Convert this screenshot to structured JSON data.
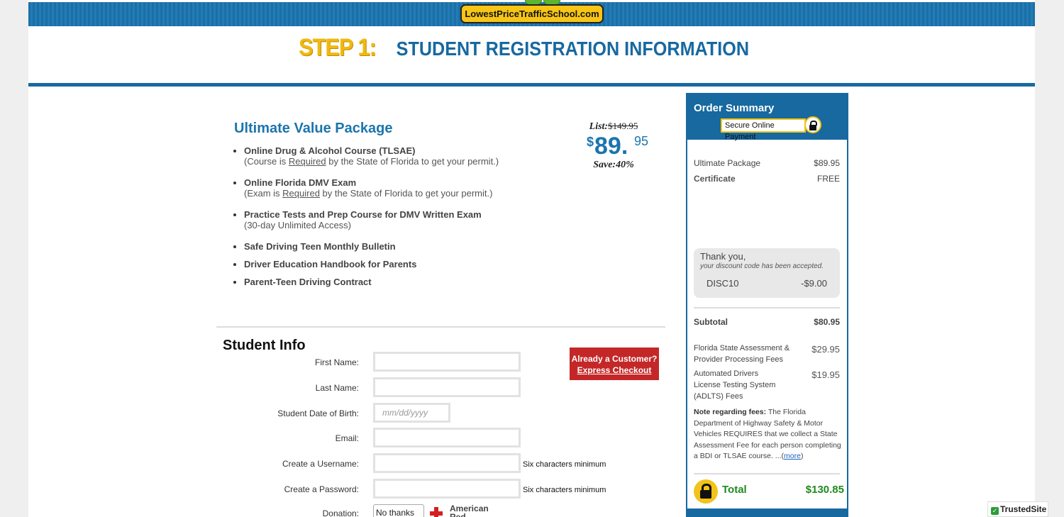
{
  "header": {
    "logo": "LowestPriceTrafficSchool.com",
    "step_num": "STEP 1:",
    "step_text": "STUDENT REGISTRATION INFORMATION"
  },
  "package": {
    "title": "Ultimate Value Package",
    "features": [
      {
        "name": "Online Drug & Alcohol Course (TLSAE)",
        "note_pre": "(Course is ",
        "note_u": "Required",
        "note_post": " by the State of Florida to get your permit.)"
      },
      {
        "name": "Online Florida DMV Exam",
        "note_pre": "(Exam is ",
        "note_u": "Required",
        "note_post": " by the State of Florida to get your permit.)"
      },
      {
        "name": "Practice Tests and Prep Course for DMV Written Exam",
        "note_pre": "(30-day Unlimited Access)",
        "note_u": "",
        "note_post": ""
      },
      {
        "name": "Safe Driving Teen Monthly Bulletin"
      },
      {
        "name": "Driver Education Handbook for Parents"
      },
      {
        "name": "Parent-Teen Driving Contract"
      }
    ],
    "list_label": "List:",
    "list_price": "$149.95",
    "price_dollar": "$",
    "price_whole": "89.",
    "price_cents": "95",
    "save": "Save:40%"
  },
  "student_info": {
    "title": "Student Info",
    "first_name_label": "First Name:",
    "last_name_label": "Last Name:",
    "dob_label": "Student Date of Birth:",
    "dob_placeholder": "mm/dd/yyyy",
    "email_label": "Email:",
    "username_label": "Create a Username:",
    "username_hint": "Six characters minimum",
    "password_label": "Create a Password:",
    "password_hint": "Six characters minimum",
    "donation_label": "Donation:",
    "donation_selected": "No thanks",
    "donation_org": "American Red Cross"
  },
  "already_customer": {
    "line1": "Already a Customer?",
    "line2": "Express Checkout"
  },
  "order_summary": {
    "title": "Order Summary",
    "secure": "Secure Online Payment",
    "items": [
      {
        "label": "Ultimate Package",
        "amount": "$89.95"
      },
      {
        "label": "Certificate",
        "amount": "FREE"
      }
    ],
    "thank_you": "Thank you,",
    "accepted": "your discount code has been accepted.",
    "discount_code": "DISC10",
    "discount_amount": "-$9.00",
    "subtotal_label": "Subtotal",
    "subtotal_amount": "$80.95",
    "fee1_label": "Florida State Assessment & Provider Processing Fees",
    "fee1_amount": "$29.95",
    "fee2_label": "Automated Drivers License Testing System (ADLTS) Fees",
    "fee2_amount": "$19.95",
    "note_bold": "Note regarding fees:",
    "note_text": " The Florida Department of Highway Safety & Motor Vehicles REQUIRES that we collect a State Assessment Fee for each person completing a BDI or TLSAE course. ...(",
    "note_more": "more",
    "note_close": ")",
    "total_label": "Total",
    "total_amount": "$130.85"
  },
  "badge": {
    "trusted": "TrustedSite"
  },
  "colors": {
    "brand_blue": "#1769a0",
    "step_gold": "#f0b90f",
    "cta_red": "#c42727",
    "total_green": "#1e8a1e"
  }
}
